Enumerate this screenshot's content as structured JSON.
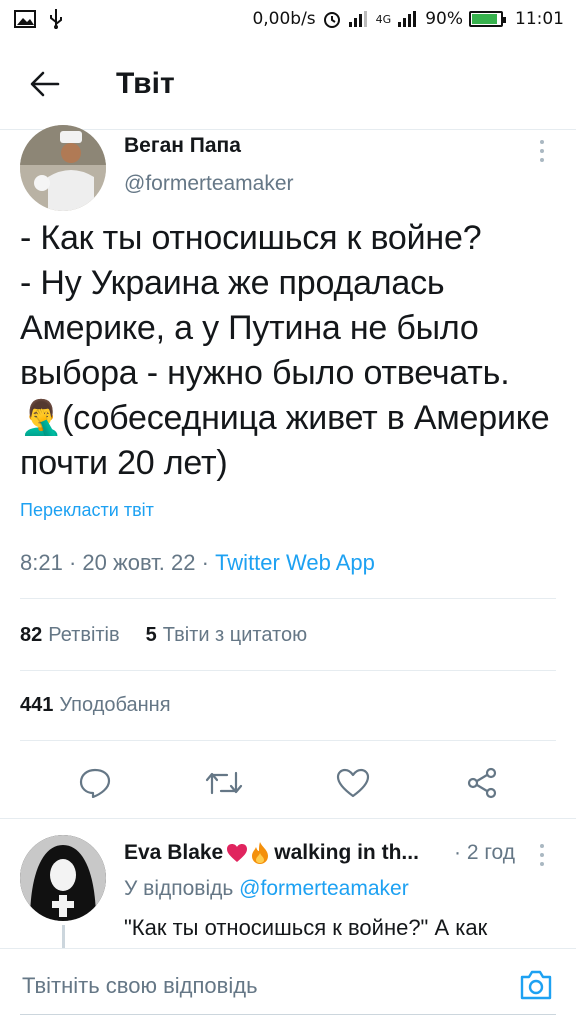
{
  "status_bar": {
    "network_speed": "0,00b/s",
    "network_type": "4G",
    "battery_percent": "90%",
    "battery_level": 0.9,
    "time": "11:01"
  },
  "header": {
    "title": "Твіт"
  },
  "tweet": {
    "author_name": "Веган Папа",
    "author_handle": "@formerteamaker",
    "text": "- Как ты относишься к войне?\n- Ну Украина же продалась Америке, а у Путина не было выбора - нужно было отвечать. 🤦‍♂(собеседница живет в Америке почти 20 лет)",
    "translate_label": "Перекласти твіт",
    "time": "8:21",
    "date": "20 жовт. 22",
    "source_app": "Twitter Web App",
    "retweets_count": "82",
    "retweets_label": "Ретвітів",
    "quotes_count": "5",
    "quotes_label": "Твіти з цитатою",
    "likes_count": "441",
    "likes_label": "Уподобання"
  },
  "reply": {
    "author_name": "Eva Blake",
    "author_name_suffix": "walking in th...",
    "time": "2 год",
    "reply_to_prefix": "У відповідь",
    "reply_to_handle": "@formerteamaker",
    "text": "\"Как ты относишься к войне?\" А как"
  },
  "compose": {
    "placeholder": "Твітніть свою відповідь"
  },
  "colors": {
    "accent": "#1da1f2",
    "secondary_text": "#657786",
    "divider": "#e6ecf0",
    "battery": "#37b24d",
    "heart_emoji": "#e0245e",
    "fire_emoji": "#f4900c"
  }
}
